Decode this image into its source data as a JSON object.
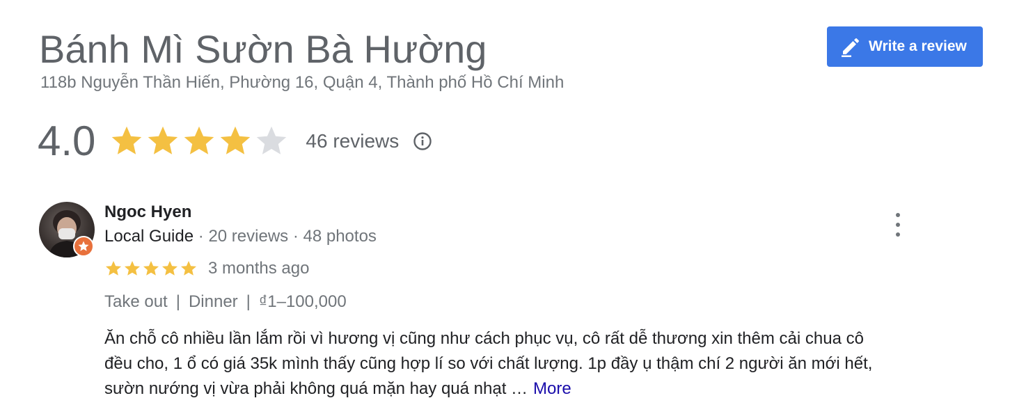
{
  "place": {
    "title": "Bánh Mì Sườn Bà Hường",
    "address": "118b Nguyễn Thần Hiến, Phường 16, Quận 4, Thành phố Hồ Chí Minh",
    "rating": "4.0",
    "rating_value": 4.0,
    "rating_max": 5,
    "reviews_count": "46 reviews"
  },
  "actions": {
    "write_review_label": "Write a review",
    "write_review_icon": "pencil-icon"
  },
  "colors": {
    "accent": "#3b78e7",
    "star_filled": "#f4c042",
    "star_empty": "#dadce0",
    "link": "#1a0dab",
    "badge": "#e8713c"
  },
  "review": {
    "author": "Ngoc Hyen",
    "guide_label": "Local Guide",
    "dot": "·",
    "reviews": "20 reviews",
    "photos": "48 photos",
    "stars": 5,
    "time": "3 months ago",
    "tags": [
      "Take out",
      "Dinner",
      "₫1–100,000"
    ],
    "tag_separator": "|",
    "text_lines": [
      "Ăn chỗ cô nhiều lần lắm rồi vì hương vị cũng như cách phục vụ, cô rất dễ thương xin thêm cải chua cô",
      "đều cho, 1 ổ có giá 35k mình thấy cũng hợp lí so với chất lượng. 1p đầy ụ thậm chí 2 người ăn mới hết,",
      "sườn nướng vị vừa phải không quá mặn hay quá nhạt …"
    ],
    "more_label": "More"
  }
}
